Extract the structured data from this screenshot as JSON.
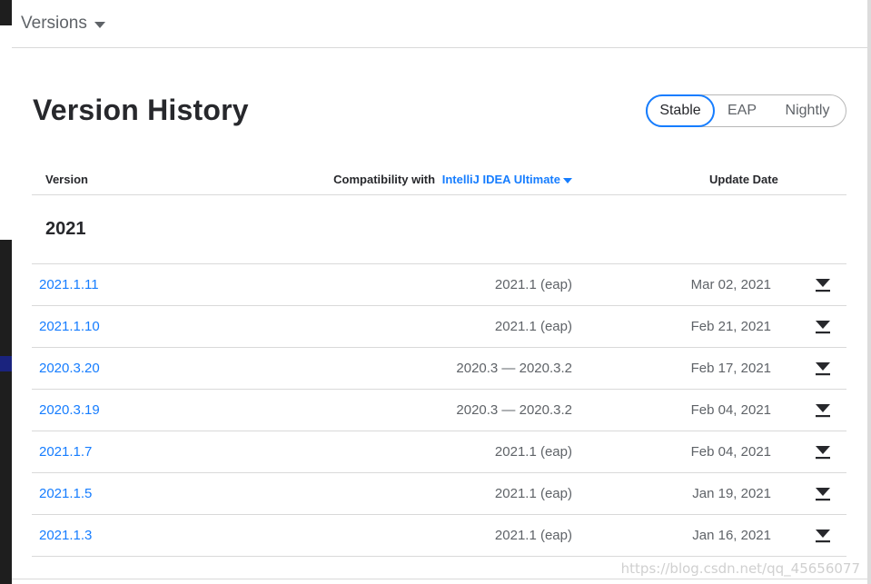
{
  "header": {
    "title": "Versions"
  },
  "page": {
    "title": "Version History"
  },
  "channels": {
    "stable": "Stable",
    "eap": "EAP",
    "nightly": "Nightly",
    "selected": "Stable"
  },
  "table": {
    "col_version": "Version",
    "col_compat_prefix": "Compatibility with",
    "col_compat_product": "IntelliJ IDEA Ultimate",
    "col_date": "Update Date",
    "year": "2021",
    "rows": [
      {
        "version": "2021.1.11",
        "compat": "2021.1 (eap)",
        "date": "Mar 02, 2021"
      },
      {
        "version": "2021.1.10",
        "compat": "2021.1 (eap)",
        "date": "Feb 21, 2021"
      },
      {
        "version": "2020.3.20",
        "compat": "2020.3 — 2020.3.2",
        "date": "Feb 17, 2021"
      },
      {
        "version": "2020.3.19",
        "compat": "2020.3 — 2020.3.2",
        "date": "Feb 04, 2021"
      },
      {
        "version": "2021.1.7",
        "compat": "2021.1 (eap)",
        "date": "Feb 04, 2021"
      },
      {
        "version": "2021.1.5",
        "compat": "2021.1 (eap)",
        "date": "Jan 19, 2021"
      },
      {
        "version": "2021.1.3",
        "compat": "2021.1 (eap)",
        "date": "Jan 16, 2021"
      }
    ]
  },
  "watermark": "https://blog.csdn.net/qq_45656077",
  "colors": {
    "accent": "#167dff",
    "text": "#27282c",
    "muted": "#5f6368"
  },
  "icons": {
    "row_action": "download-icon",
    "dropdown": "caret-down-icon"
  }
}
